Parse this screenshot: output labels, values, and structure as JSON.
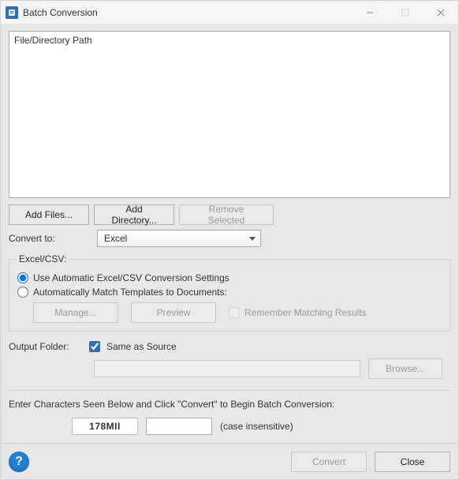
{
  "window": {
    "title": "Batch Conversion"
  },
  "file_list": {
    "column_header": "File/Directory Path",
    "items": []
  },
  "buttons": {
    "add_files": "Add Files...",
    "add_directory": "Add Directory...",
    "remove_selected": "Remove Selected",
    "manage": "Manage...",
    "preview": "Preview",
    "browse": "Browse...",
    "convert": "Convert",
    "close": "Close"
  },
  "labels": {
    "convert_to": "Convert to:",
    "output_folder": "Output Folder:",
    "same_as_source": "Same as Source",
    "remember_matching": "Remember Matching Results",
    "captcha_prompt": "Enter Characters Seen Below and Click \"Convert\" to Begin Batch Conversion:",
    "captcha_hint": "(case insensitive)"
  },
  "convert_to": {
    "selected": "Excel"
  },
  "group": {
    "legend": "Excel/CSV:",
    "option_auto": "Use Automatic Excel/CSV Conversion Settings",
    "option_match": "Automatically Match Templates to Documents:",
    "selected": "auto"
  },
  "output": {
    "same_as_source": true,
    "path": ""
  },
  "captcha": {
    "code": "178MII",
    "entered": ""
  },
  "colors": {
    "accent_blue": "#2f6fb7",
    "help_blue": "#1f7fd4"
  }
}
